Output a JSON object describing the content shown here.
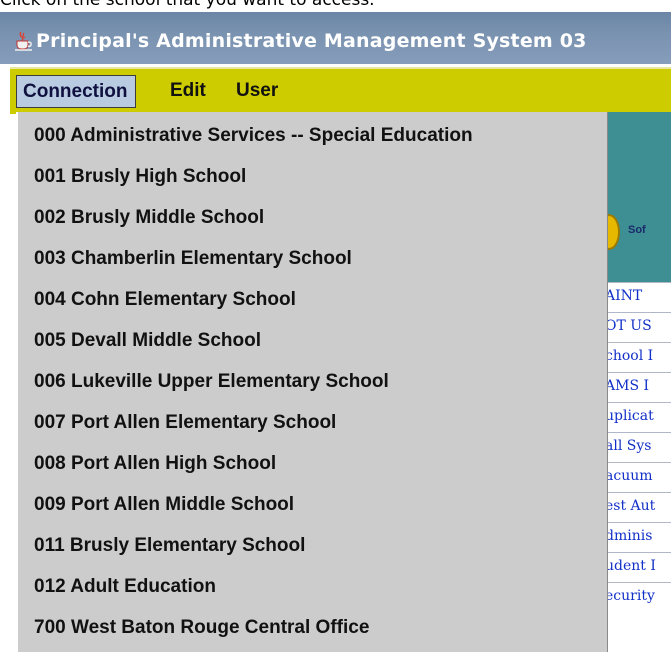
{
  "instruction": "Click on the school that you want to access.",
  "window": {
    "title": "Principal's Administrative Management System  03",
    "icon": "java-coffee-cup-icon"
  },
  "menubar": {
    "items": [
      "Connection",
      "Edit",
      "User"
    ],
    "active": "Connection"
  },
  "connection_menu": {
    "items": [
      "000 Administrative Services -- Special Education",
      "001 Brusly High School",
      "002 Brusly Middle School",
      "003 Chamberlin Elementary School",
      "004 Cohn Elementary School",
      "005 Devall Middle School",
      "006 Lukeville Upper Elementary School",
      "007 Port Allen Elementary School",
      "008 Port Allen High School",
      "009 Port Allen Middle School",
      "011 Brusly Elementary School",
      "012 Adult Education",
      "700 West Baton Rouge Central Office"
    ]
  },
  "background": {
    "logo_text": "Sof",
    "list_items": [
      "AINT",
      "OT US",
      "chool I",
      "AMS I",
      "uplicat",
      "all Sys",
      "acuum",
      "est Aut",
      "dminis",
      "udent I",
      "ecurity"
    ]
  },
  "colors": {
    "titlebar": "#7a93b0",
    "menubar": "#cccc00",
    "menu_background": "#cccccc",
    "link_text": "#1230c8",
    "panel_teal": "#3e8f94"
  }
}
